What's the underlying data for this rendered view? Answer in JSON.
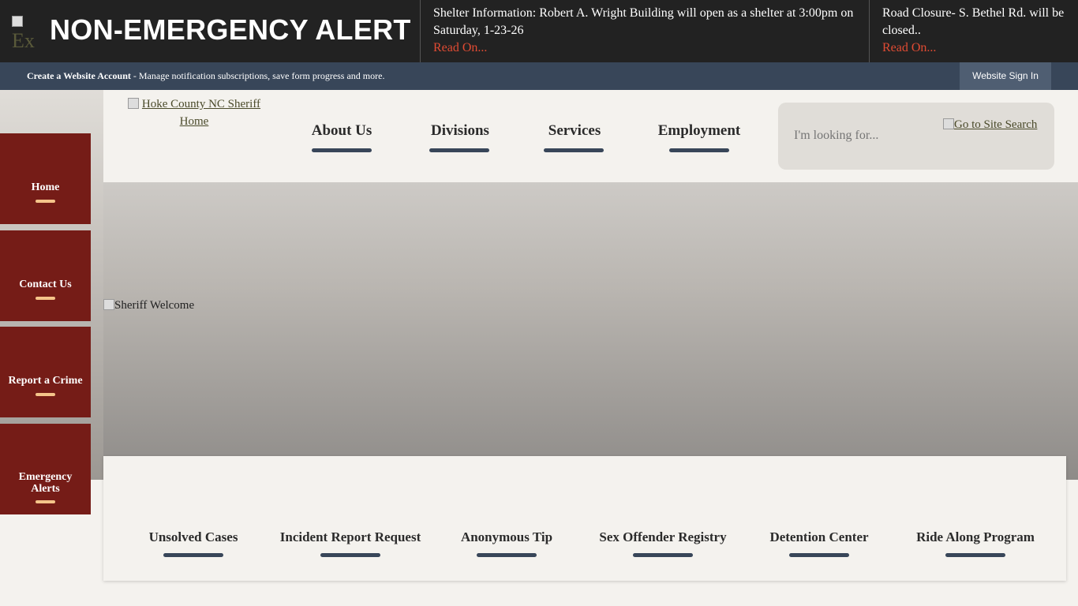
{
  "alert_bar": {
    "icon_alt": "Ex",
    "title": "NON-EMERGENCY ALERT",
    "items": [
      {
        "text": "Shelter Information: Robert A. Wright Building will open as a shelter at 3:00pm on Saturday, 1-23-26",
        "link": "Read On..."
      },
      {
        "text": "Road Closure- S. Bethel Rd. will be closed..",
        "link": "Read On..."
      }
    ]
  },
  "account_bar": {
    "create_label": "Create a Website Account",
    "create_desc": " - Manage notification subscriptions, save form progress and more.",
    "signin_label": "Website Sign In"
  },
  "header": {
    "logo_alt_line1": "Hoke County NC Sheriff",
    "logo_alt_line2": "Home",
    "nav": [
      "About Us",
      "Divisions",
      "Services",
      "Employment"
    ],
    "search_placeholder": "I'm looking for...",
    "search_button_alt": "Go to Site Search"
  },
  "hero": {
    "image_alt": "Sheriff Welcome"
  },
  "side_buttons": [
    {
      "line1": "Home",
      "line2": ""
    },
    {
      "line1": "Contact Us",
      "line2": ""
    },
    {
      "line1": "Report a Crime",
      "line2": ""
    },
    {
      "line1": "Emergency",
      "line2": "Alerts"
    }
  ],
  "quick_links": [
    "Unsolved Cases",
    "Incident Report Request",
    "Anonymous Tip",
    "Sex Offender Registry",
    "Detention Center",
    "Ride Along Program"
  ],
  "colors": {
    "alert_bg": "#222222",
    "read_on": "#e04b33",
    "account_bar": "#384659",
    "side_button": "#751c17",
    "side_accent": "#f5c48a",
    "underline_bar": "#384659"
  }
}
